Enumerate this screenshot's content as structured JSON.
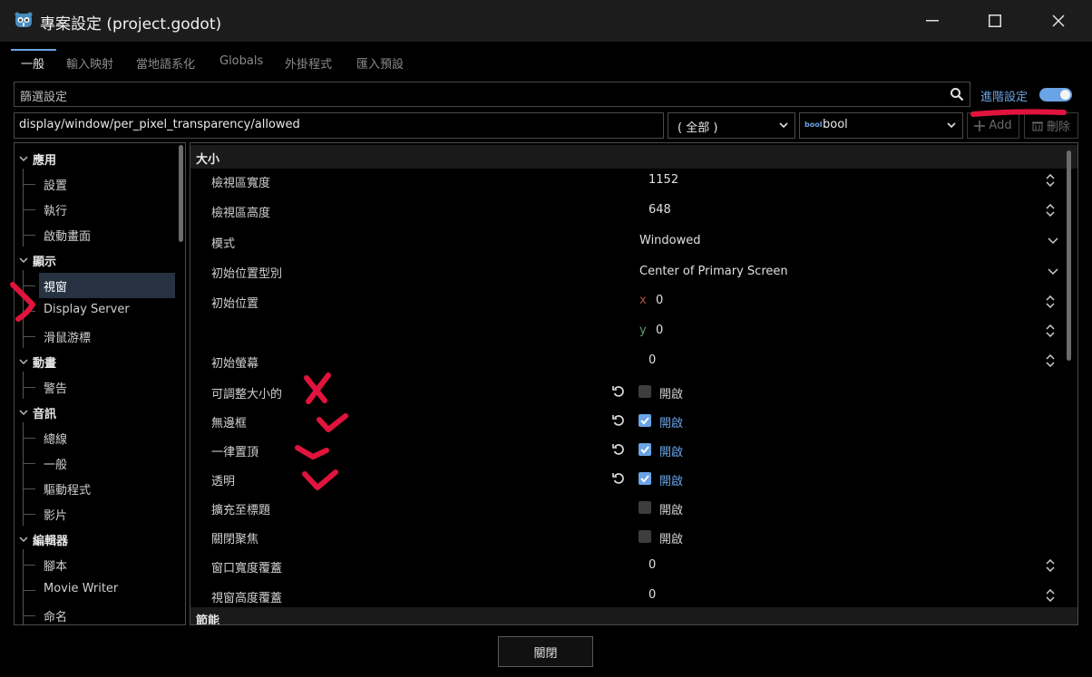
{
  "window": {
    "title": "專案設定 (project.godot)"
  },
  "tabs": [
    {
      "label": "一般",
      "active": true
    },
    {
      "label": "輸入映射",
      "active": false
    },
    {
      "label": "當地語系化",
      "active": false
    },
    {
      "label": "Globals",
      "active": false
    },
    {
      "label": "外掛程式",
      "active": false
    },
    {
      "label": "匯入預設",
      "active": false
    }
  ],
  "filter": {
    "placeholder": "篩選設定",
    "advanced_label": "進階設定",
    "advanced_on": true
  },
  "path_bar": {
    "path": "display/window/per_pixel_transparency/allowed",
    "feature_select": "( 全部 )",
    "type_icon": "bool",
    "type_select": "bool",
    "add_label": "Add",
    "delete_label": "刪除"
  },
  "sidebar": {
    "items": [
      {
        "label": "應用",
        "level": 0
      },
      {
        "label": "設置",
        "level": 1
      },
      {
        "label": "執行",
        "level": 1
      },
      {
        "label": "啟動畫面",
        "level": 1
      },
      {
        "label": "顯示",
        "level": 0
      },
      {
        "label": "視窗",
        "level": 1,
        "selected": true
      },
      {
        "label": "Display Server",
        "level": 1
      },
      {
        "label": "滑鼠游標",
        "level": 1
      },
      {
        "label": "動畫",
        "level": 0
      },
      {
        "label": "警告",
        "level": 1
      },
      {
        "label": "音訊",
        "level": 0
      },
      {
        "label": "總線",
        "level": 1
      },
      {
        "label": "一般",
        "level": 1
      },
      {
        "label": "驅動程式",
        "level": 1
      },
      {
        "label": "影片",
        "level": 1
      },
      {
        "label": "編輯器",
        "level": 0
      },
      {
        "label": "腳本",
        "level": 1
      },
      {
        "label": "Movie Writer",
        "level": 1
      },
      {
        "label": "命名",
        "level": 1
      }
    ]
  },
  "content": {
    "section_size": "大小",
    "section_energy": "節能",
    "props": {
      "viewport_width": {
        "label": "檢視區寬度",
        "value": "1152"
      },
      "viewport_height": {
        "label": "檢視區高度",
        "value": "648"
      },
      "mode": {
        "label": "模式",
        "value": "Windowed"
      },
      "initial_position_type": {
        "label": "初始位置型別",
        "value": "Center of Primary Screen"
      },
      "initial_position": {
        "label": "初始位置",
        "x_axis": "x",
        "x": "0",
        "y_axis": "y",
        "y": "0"
      },
      "initial_screen": {
        "label": "初始螢幕",
        "value": "0"
      },
      "resizable": {
        "label": "可調整大小的",
        "checked": false,
        "text": "開啟"
      },
      "borderless": {
        "label": "無邊框",
        "checked": true,
        "text": "開啟"
      },
      "always_on_top": {
        "label": "一律置頂",
        "checked": true,
        "text": "開啟"
      },
      "transparent": {
        "label": "透明",
        "checked": true,
        "text": "開啟"
      },
      "extend_to_title": {
        "label": "擴充至標題",
        "checked": false,
        "text": "開啟"
      },
      "no_focus": {
        "label": "關閉聚焦",
        "checked": false,
        "text": "開啟"
      },
      "window_width_override": {
        "label": "窗口寬度覆蓋",
        "value": "0"
      },
      "window_height_override": {
        "label": "視窗高度覆蓋",
        "value": "0"
      }
    }
  },
  "footer": {
    "close_label": "關閉"
  },
  "colors": {
    "accent": "#6aa3e6",
    "annotation": "#e0143c",
    "selection": "#263241"
  }
}
